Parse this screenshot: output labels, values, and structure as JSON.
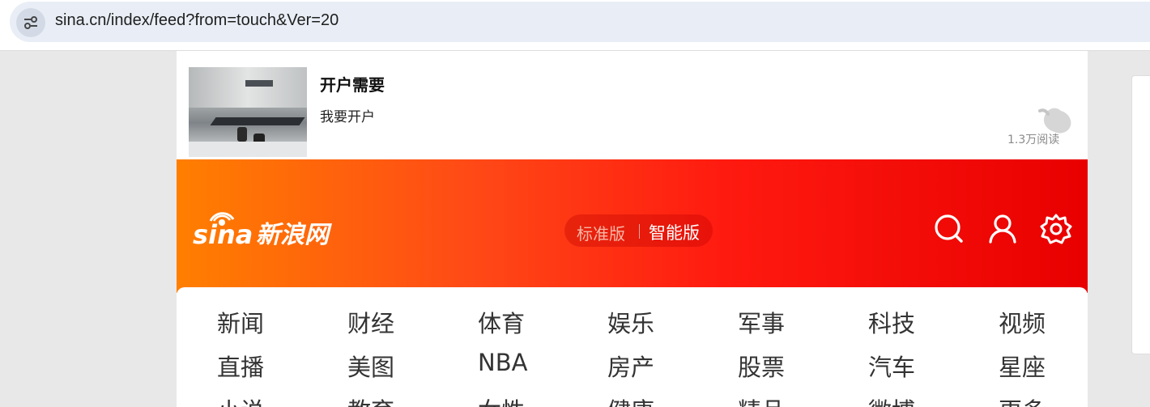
{
  "browser": {
    "url": "sina.cn/index/feed?from=touch&Ver=20",
    "site_info_icon": "tune-icon"
  },
  "news_card": {
    "title": "开户需要",
    "description": "我要开户",
    "reads": "1.3万阅读",
    "thumbnail_icon": "office-photo"
  },
  "header": {
    "logo_text": "新浪网",
    "logo_brand": "sina",
    "switch": {
      "standard_label": "标准版",
      "smart_label": "智能版"
    },
    "icons": [
      "search-icon",
      "user-icon",
      "settings-icon"
    ],
    "gradient": [
      "#ff7f00",
      "#e80000"
    ]
  },
  "nav": {
    "rows": [
      [
        "新闻",
        "财经",
        "体育",
        "娱乐",
        "军事",
        "科技",
        "视频"
      ],
      [
        "直播",
        "美图",
        "NBA",
        "房产",
        "股票",
        "汽车",
        "星座"
      ],
      [
        "小说",
        "教育",
        "女性",
        "健康",
        "精品",
        "微博",
        "更多"
      ]
    ]
  }
}
